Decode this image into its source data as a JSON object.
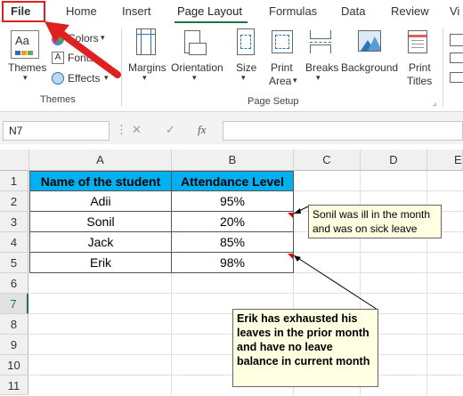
{
  "tabs": [
    "File",
    "Home",
    "Insert",
    "Page Layout",
    "Formulas",
    "Data",
    "Review",
    "Vi"
  ],
  "ribbon": {
    "themes_label": "Themes",
    "colors_label": "Colors",
    "fonts_label": "Fonts",
    "effects_label": "Effects",
    "margins_label": "Margins",
    "orientation_label": "Orientation",
    "size_label": "Size",
    "print_area_label1": "Print",
    "print_area_label2": "Area",
    "breaks_label": "Breaks",
    "background_label": "Background",
    "print_titles_label1": "Print",
    "print_titles_label2": "Titles",
    "group_themes": "Themes",
    "group_page_setup": "Page Setup"
  },
  "formula_bar": {
    "name_box": "N7",
    "cancel": "✕",
    "enter": "✓",
    "fx": "fx",
    "value": ""
  },
  "columns": [
    "A",
    "B",
    "C",
    "D",
    "E"
  ],
  "rows": [
    "1",
    "2",
    "3",
    "4",
    "5",
    "6",
    "7",
    "8",
    "9",
    "10",
    "11"
  ],
  "table": {
    "headers": [
      "Name of the student",
      "Attendance Level"
    ],
    "rows": [
      [
        "Adii",
        "95%"
      ],
      [
        "Sonil",
        "20%"
      ],
      [
        "Jack",
        "85%"
      ],
      [
        "Erik",
        "98%"
      ]
    ]
  },
  "notes": {
    "sonil": "Sonil was ill in the month and was on sick leave",
    "erik": "Erik has exhausted his leaves in the prior month and have no leave balance in current month"
  },
  "colors": {
    "accent": "#217346",
    "header_fill": "#00b0f0",
    "annotation_red": "#e02020",
    "note_fill": "#ffffe1"
  }
}
